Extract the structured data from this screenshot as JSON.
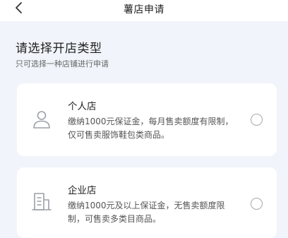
{
  "header": {
    "title": "薯店申请"
  },
  "page": {
    "heading": "请选择开店类型",
    "subheading": "只可选择一种店铺进行申请"
  },
  "options": [
    {
      "title": "个人店",
      "description": "缴纳1000元保证金，每月售卖额度有限制，仅可售卖服饰鞋包类商品。",
      "icon": "person-icon",
      "selected": false
    },
    {
      "title": "企业店",
      "description": "缴纳1000元及以上保证金，无售卖额度限制，可售卖多类目商品。",
      "icon": "building-icon",
      "selected": false
    }
  ]
}
